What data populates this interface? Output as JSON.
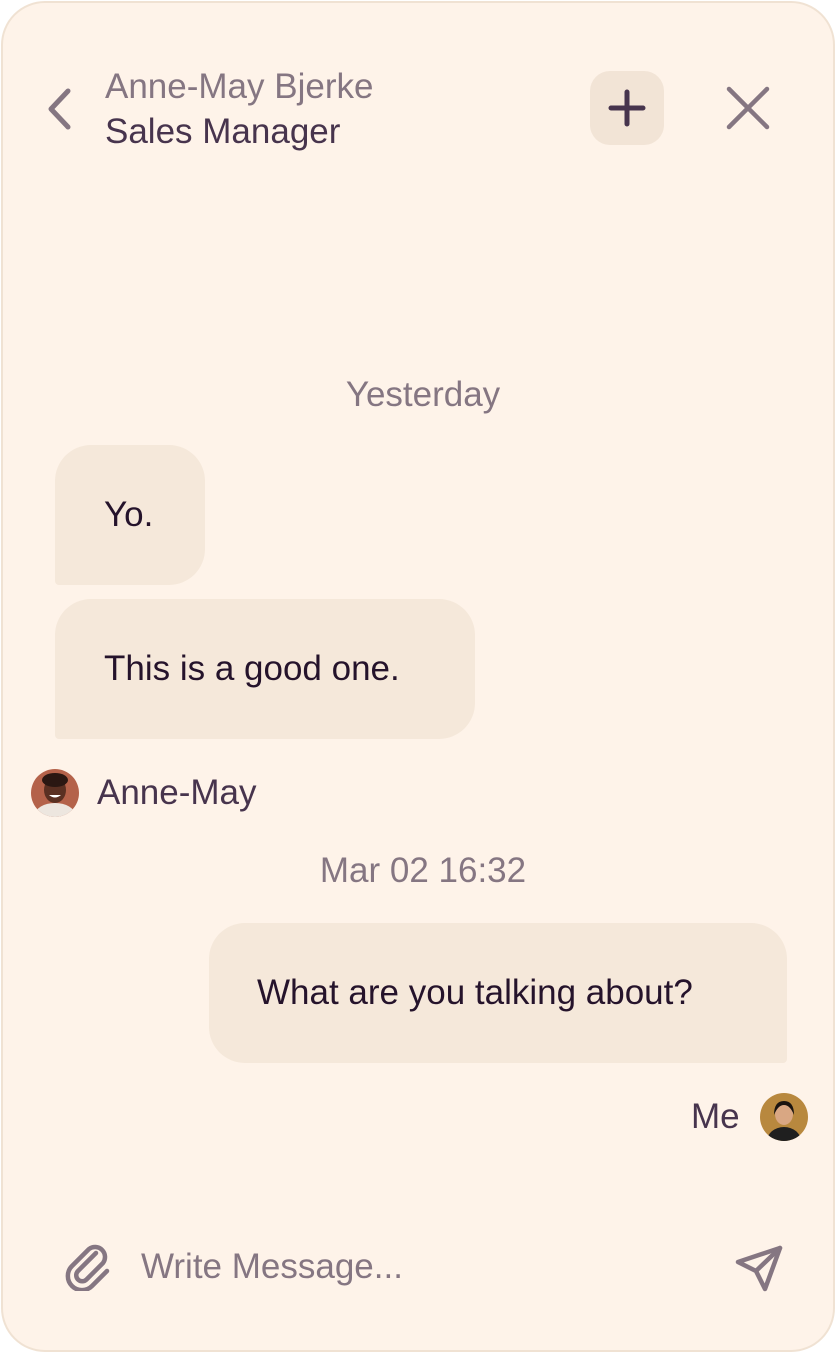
{
  "header": {
    "contact_name": "Anne-May Bjerke",
    "contact_role": "Sales Manager",
    "back_icon": "chevron-left-icon",
    "add_icon": "plus-icon",
    "close_icon": "close-icon"
  },
  "conversation": {
    "groups": [
      {
        "date": "Yesterday",
        "messages": [
          {
            "text": "Yo.",
            "direction": "incoming"
          },
          {
            "text": "This is a good one.",
            "direction": "incoming"
          }
        ],
        "sender": {
          "name": "Anne-May",
          "avatar": "avatar-anne-may"
        }
      },
      {
        "date": "Mar 02 16:32",
        "messages": [
          {
            "text": "What are you talking about?",
            "direction": "outgoing"
          }
        ],
        "sender": {
          "name": "Me",
          "avatar": "avatar-me"
        }
      }
    ]
  },
  "composer": {
    "placeholder": "Write Message...",
    "value": "",
    "attach_icon": "paperclip-icon",
    "send_icon": "send-icon"
  },
  "colors": {
    "background": "#fef3e9",
    "bubble": "#f5e8da",
    "accent": "#47344d",
    "muted_text": "#857682",
    "message_text": "#25132b"
  }
}
